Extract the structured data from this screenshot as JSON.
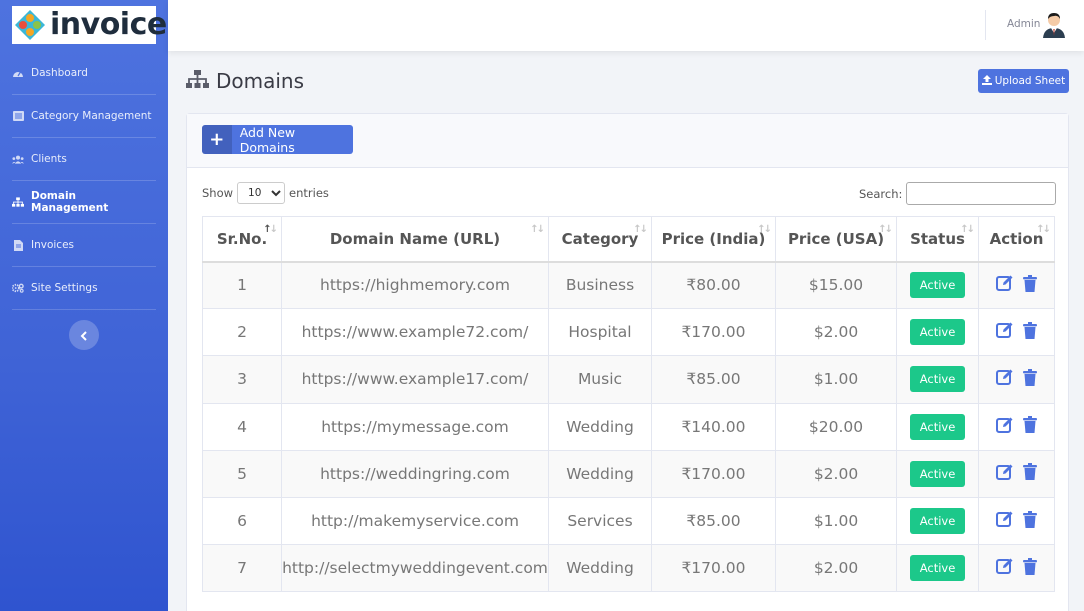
{
  "brand": {
    "name": "invoice"
  },
  "sidebar": {
    "items": [
      {
        "label": "Dashboard",
        "icon": "dashboard-icon"
      },
      {
        "label": "Category Management",
        "icon": "list-icon"
      },
      {
        "label": "Clients",
        "icon": "users-icon"
      },
      {
        "label": "Domain Management",
        "icon": "sitemap-icon",
        "active": true
      },
      {
        "label": "Invoices",
        "icon": "file-icon"
      },
      {
        "label": "Site Settings",
        "icon": "cogs-icon"
      }
    ]
  },
  "topbar": {
    "user_name": "Admin"
  },
  "page": {
    "title": "Domains",
    "upload_label": "Upload Sheet"
  },
  "card": {
    "add_label": "Add New Domains",
    "show_label": "Show",
    "entries_value": "10",
    "entries_label": "entries",
    "search_label": "Search:"
  },
  "table": {
    "headers": [
      "Sr.No.",
      "Domain Name (URL)",
      "Category",
      "Price (India)",
      "Price (USA)",
      "Status",
      "Action"
    ],
    "rows": [
      {
        "sr": "1",
        "domain": "https://highmemory.com",
        "category": "Business",
        "inr": "₹80.00",
        "usd": "$15.00",
        "status": "Active"
      },
      {
        "sr": "2",
        "domain": "https://www.example72.com/",
        "category": "Hospital",
        "inr": "₹170.00",
        "usd": "$2.00",
        "status": "Active"
      },
      {
        "sr": "3",
        "domain": "https://www.example17.com/",
        "category": "Music",
        "inr": "₹85.00",
        "usd": "$1.00",
        "status": "Active"
      },
      {
        "sr": "4",
        "domain": "https://mymessage.com",
        "category": "Wedding",
        "inr": "₹140.00",
        "usd": "$20.00",
        "status": "Active"
      },
      {
        "sr": "5",
        "domain": "https://weddingring.com",
        "category": "Wedding",
        "inr": "₹170.00",
        "usd": "$2.00",
        "status": "Active"
      },
      {
        "sr": "6",
        "domain": "http://makemyservice.com",
        "category": "Services",
        "inr": "₹85.00",
        "usd": "$1.00",
        "status": "Active"
      },
      {
        "sr": "7",
        "domain": "http://selectmyweddingevent.com",
        "category": "Wedding",
        "inr": "₹170.00",
        "usd": "$2.00",
        "status": "Active"
      }
    ]
  },
  "colors": {
    "primary": "#4e73df",
    "success": "#1cc88a",
    "sidebar_bottom": "#2f54cf"
  }
}
